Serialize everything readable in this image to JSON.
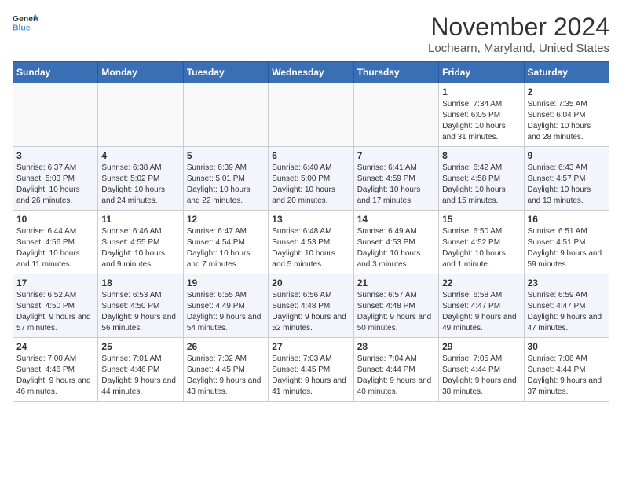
{
  "logo": {
    "line1": "General",
    "line2": "Blue"
  },
  "title": "November 2024",
  "location": "Lochearn, Maryland, United States",
  "weekdays": [
    "Sunday",
    "Monday",
    "Tuesday",
    "Wednesday",
    "Thursday",
    "Friday",
    "Saturday"
  ],
  "weeks": [
    [
      {
        "day": "",
        "info": ""
      },
      {
        "day": "",
        "info": ""
      },
      {
        "day": "",
        "info": ""
      },
      {
        "day": "",
        "info": ""
      },
      {
        "day": "",
        "info": ""
      },
      {
        "day": "1",
        "info": "Sunrise: 7:34 AM\nSunset: 6:05 PM\nDaylight: 10 hours and 31 minutes."
      },
      {
        "day": "2",
        "info": "Sunrise: 7:35 AM\nSunset: 6:04 PM\nDaylight: 10 hours and 28 minutes."
      }
    ],
    [
      {
        "day": "3",
        "info": "Sunrise: 6:37 AM\nSunset: 5:03 PM\nDaylight: 10 hours and 26 minutes."
      },
      {
        "day": "4",
        "info": "Sunrise: 6:38 AM\nSunset: 5:02 PM\nDaylight: 10 hours and 24 minutes."
      },
      {
        "day": "5",
        "info": "Sunrise: 6:39 AM\nSunset: 5:01 PM\nDaylight: 10 hours and 22 minutes."
      },
      {
        "day": "6",
        "info": "Sunrise: 6:40 AM\nSunset: 5:00 PM\nDaylight: 10 hours and 20 minutes."
      },
      {
        "day": "7",
        "info": "Sunrise: 6:41 AM\nSunset: 4:59 PM\nDaylight: 10 hours and 17 minutes."
      },
      {
        "day": "8",
        "info": "Sunrise: 6:42 AM\nSunset: 4:58 PM\nDaylight: 10 hours and 15 minutes."
      },
      {
        "day": "9",
        "info": "Sunrise: 6:43 AM\nSunset: 4:57 PM\nDaylight: 10 hours and 13 minutes."
      }
    ],
    [
      {
        "day": "10",
        "info": "Sunrise: 6:44 AM\nSunset: 4:56 PM\nDaylight: 10 hours and 11 minutes."
      },
      {
        "day": "11",
        "info": "Sunrise: 6:46 AM\nSunset: 4:55 PM\nDaylight: 10 hours and 9 minutes."
      },
      {
        "day": "12",
        "info": "Sunrise: 6:47 AM\nSunset: 4:54 PM\nDaylight: 10 hours and 7 minutes."
      },
      {
        "day": "13",
        "info": "Sunrise: 6:48 AM\nSunset: 4:53 PM\nDaylight: 10 hours and 5 minutes."
      },
      {
        "day": "14",
        "info": "Sunrise: 6:49 AM\nSunset: 4:53 PM\nDaylight: 10 hours and 3 minutes."
      },
      {
        "day": "15",
        "info": "Sunrise: 6:50 AM\nSunset: 4:52 PM\nDaylight: 10 hours and 1 minute."
      },
      {
        "day": "16",
        "info": "Sunrise: 6:51 AM\nSunset: 4:51 PM\nDaylight: 9 hours and 59 minutes."
      }
    ],
    [
      {
        "day": "17",
        "info": "Sunrise: 6:52 AM\nSunset: 4:50 PM\nDaylight: 9 hours and 57 minutes."
      },
      {
        "day": "18",
        "info": "Sunrise: 6:53 AM\nSunset: 4:50 PM\nDaylight: 9 hours and 56 minutes."
      },
      {
        "day": "19",
        "info": "Sunrise: 6:55 AM\nSunset: 4:49 PM\nDaylight: 9 hours and 54 minutes."
      },
      {
        "day": "20",
        "info": "Sunrise: 6:56 AM\nSunset: 4:48 PM\nDaylight: 9 hours and 52 minutes."
      },
      {
        "day": "21",
        "info": "Sunrise: 6:57 AM\nSunset: 4:48 PM\nDaylight: 9 hours and 50 minutes."
      },
      {
        "day": "22",
        "info": "Sunrise: 6:58 AM\nSunset: 4:47 PM\nDaylight: 9 hours and 49 minutes."
      },
      {
        "day": "23",
        "info": "Sunrise: 6:59 AM\nSunset: 4:47 PM\nDaylight: 9 hours and 47 minutes."
      }
    ],
    [
      {
        "day": "24",
        "info": "Sunrise: 7:00 AM\nSunset: 4:46 PM\nDaylight: 9 hours and 46 minutes."
      },
      {
        "day": "25",
        "info": "Sunrise: 7:01 AM\nSunset: 4:46 PM\nDaylight: 9 hours and 44 minutes."
      },
      {
        "day": "26",
        "info": "Sunrise: 7:02 AM\nSunset: 4:45 PM\nDaylight: 9 hours and 43 minutes."
      },
      {
        "day": "27",
        "info": "Sunrise: 7:03 AM\nSunset: 4:45 PM\nDaylight: 9 hours and 41 minutes."
      },
      {
        "day": "28",
        "info": "Sunrise: 7:04 AM\nSunset: 4:44 PM\nDaylight: 9 hours and 40 minutes."
      },
      {
        "day": "29",
        "info": "Sunrise: 7:05 AM\nSunset: 4:44 PM\nDaylight: 9 hours and 38 minutes."
      },
      {
        "day": "30",
        "info": "Sunrise: 7:06 AM\nSunset: 4:44 PM\nDaylight: 9 hours and 37 minutes."
      }
    ]
  ]
}
